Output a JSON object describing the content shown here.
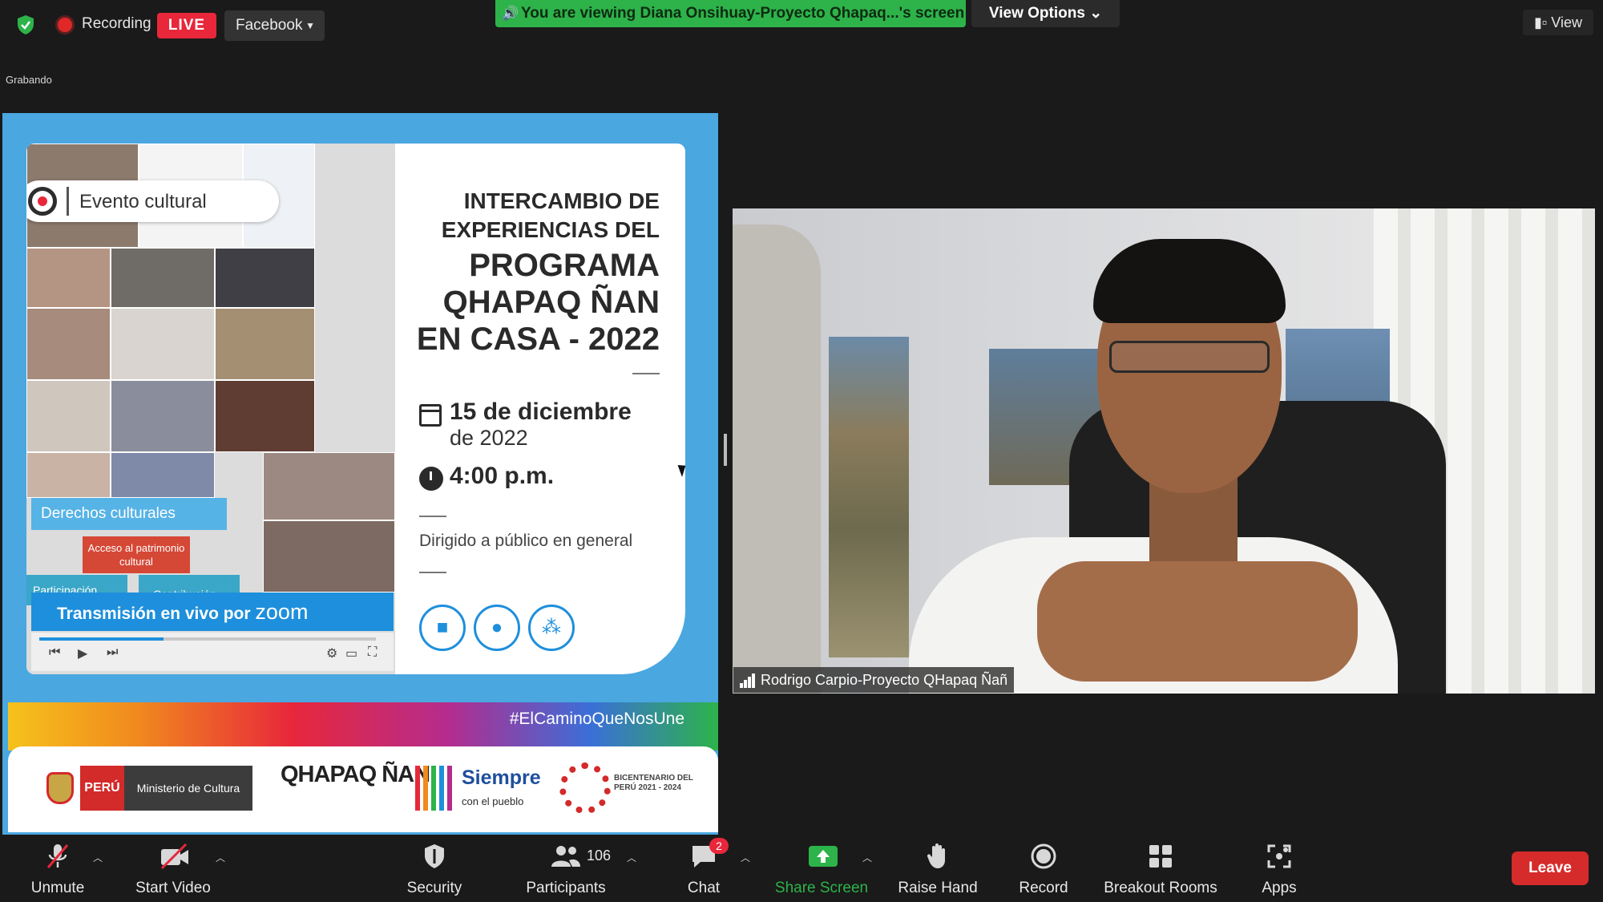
{
  "top_bar": {
    "recording_label": "Recording",
    "live_label": "LIVE",
    "stream_platform": "Facebook",
    "recording_status": "Grabando",
    "share_banner": "You are viewing Diana Onsihuay-Proyecto Qhapaq...'s screen",
    "view_options_label": "View Options",
    "view_label": "View"
  },
  "shared_screen": {
    "badge": "Evento cultural",
    "title_lines": [
      "INTERCAMBIO DE",
      "EXPERIENCIAS DEL",
      "PROGRAMA",
      "QHAPAQ ÑAN",
      "EN CASA - 2022"
    ],
    "date_line1": "15 de diciembre",
    "date_line2": "de 2022",
    "time": "4:00 p.m.",
    "audience": "Dirigido a público en general",
    "derechos": "Derechos culturales",
    "acceso": "Acceso al patrimonio cultural",
    "participacion": "Participación",
    "contribucion": "Contribución",
    "transmision": "Transmisión en vivo por",
    "zoom_logo": "zoom",
    "hashtag": "#ElCaminoQueNosUne",
    "logo_peru": "PERÚ",
    "logo_ministerio": "Ministerio de Cultura",
    "logo_qhapaq": "QHAPAQ ÑAN",
    "logo_siempre": "Siempre",
    "logo_pueblo": "con el pueblo",
    "logo_bicentenario": "BICENTENARIO DEL PERÚ 2021 - 2024"
  },
  "participant_video": {
    "name": "Rodrigo Carpio-Proyecto QHapaq Ñañ"
  },
  "toolbar": {
    "unmute": "Unmute",
    "start_video": "Start Video",
    "security": "Security",
    "participants": "Participants",
    "participants_count": "106",
    "chat": "Chat",
    "chat_badge": "2",
    "share_screen": "Share Screen",
    "raise_hand": "Raise Hand",
    "record": "Record",
    "breakout_rooms": "Breakout Rooms",
    "apps": "Apps",
    "leave": "Leave"
  },
  "colors": {
    "live_red": "#e8273b",
    "share_green": "#2db34a",
    "leave_red": "#d62b2b",
    "background": "#1a1a1a"
  },
  "icons": [
    "shield-check-icon",
    "recording-dot-icon",
    "speaker-icon",
    "microphone-muted-icon",
    "video-off-icon",
    "security-shield-icon",
    "participants-icon",
    "chat-icon",
    "share-screen-icon",
    "raise-hand-icon",
    "record-icon",
    "breakout-rooms-icon",
    "apps-icon",
    "signal-bars-icon"
  ]
}
